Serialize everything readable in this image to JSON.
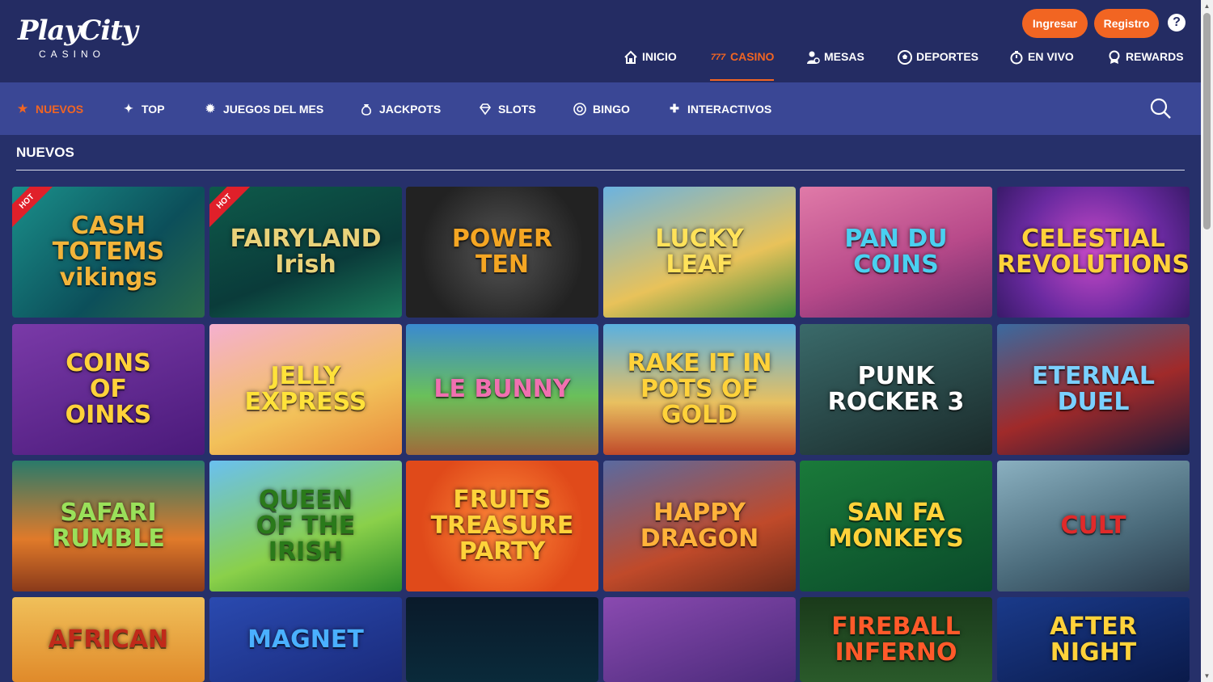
{
  "brand": {
    "logo_main": "PlayCity",
    "logo_sub": "CASINO"
  },
  "header": {
    "login_label": "Ingresar",
    "register_label": "Registro",
    "help_label": "?",
    "accent_color": "#f26522"
  },
  "mainnav": [
    {
      "label": "INICIO",
      "icon": "home-icon",
      "active": false
    },
    {
      "label": "CASINO",
      "icon": "777-icon",
      "active": true
    },
    {
      "label": "MESAS",
      "icon": "dealer-icon",
      "active": false
    },
    {
      "label": "DEPORTES",
      "icon": "soccer-ball-icon",
      "active": false
    },
    {
      "label": "EN VIVO",
      "icon": "stopwatch-icon",
      "active": false
    },
    {
      "label": "REWARDS",
      "icon": "award-icon",
      "active": false
    }
  ],
  "subnav": [
    {
      "label": "NUEVOS",
      "icon": "star-icon",
      "active": true
    },
    {
      "label": "TOP",
      "icon": "sparkles-icon",
      "active": false
    },
    {
      "label": "JUEGOS DEL MES",
      "icon": "badge-icon",
      "active": false
    },
    {
      "label": "JACKPOTS",
      "icon": "money-bag-icon",
      "active": false
    },
    {
      "label": "SLOTS",
      "icon": "diamond-icon",
      "active": false
    },
    {
      "label": "BINGO",
      "icon": "bingo-ball-icon",
      "active": false
    },
    {
      "label": "INTERACTIVOS",
      "icon": "puzzle-icon",
      "active": false
    }
  ],
  "section": {
    "title": "NUEVOS"
  },
  "games": [
    {
      "title": "CASH\nTOTEMS\nvikings",
      "hot": true,
      "bg": "linear-gradient(135deg,#1a8f8a,#0c4f5a 60%,#2a6a4a)",
      "color": "#f2b43a"
    },
    {
      "title": "FAIRYLAND\nIrish",
      "hot": true,
      "bg": "linear-gradient(160deg,#0e5a4a,#0a3b3a 60%,#1b7a5a)",
      "color": "#e9d27a"
    },
    {
      "title": "POWER\nTEN",
      "hot": false,
      "bg": "radial-gradient(circle,#555 0%,#222 70%)",
      "color": "#f5a623"
    },
    {
      "title": "LUCKY\nLEAF",
      "hot": false,
      "bg": "linear-gradient(160deg,#6bb3e0,#e8c25a 60%,#3a8a3a)",
      "color": "#ffe25a"
    },
    {
      "title": "PAN DU\nCOINS",
      "hot": false,
      "bg": "linear-gradient(160deg,#e07aa8,#b84a8a 55%,#6a2a6a)",
      "color": "#4ad0f0"
    },
    {
      "title": "CELESTIAL\nREVOLUTIONS",
      "hot": false,
      "bg": "radial-gradient(circle,#c84ac8 0%,#6a2aa0 60%,#3a1a6a)",
      "color": "#ffd23a"
    },
    {
      "title": "COINS\nOF\nOINKS",
      "hot": false,
      "bg": "linear-gradient(160deg,#7a3aa8,#4a1a7a)",
      "color": "#ffd23a"
    },
    {
      "title": "JELLY\nEXPRESS",
      "hot": false,
      "bg": "linear-gradient(160deg,#f5b0d0,#f2c15a 60%,#e88a3a)",
      "color": "#ffe23a"
    },
    {
      "title": "LE BUNNY",
      "hot": false,
      "bg": "linear-gradient(180deg,#3a8ad0,#6ac05a 55%,#a06a3a)",
      "color": "#f070b0"
    },
    {
      "title": "RAKE IT IN\nPOTS OF GOLD",
      "hot": false,
      "bg": "linear-gradient(180deg,#5ab0e0,#e8c060 60%,#c04a2a)",
      "color": "#ffd23a"
    },
    {
      "title": "PUNK\nROCKER 3",
      "hot": false,
      "bg": "linear-gradient(160deg,#3a6a6a,#1a2a2a)",
      "color": "#ffffff"
    },
    {
      "title": "ETERNAL\nDUEL",
      "hot": false,
      "bg": "linear-gradient(160deg,#3a6aa0,#a02a2a 55%,#1a1a3a)",
      "color": "#7ad0ff"
    },
    {
      "title": "SAFARI\nRUMBLE",
      "hot": false,
      "bg": "linear-gradient(180deg,#2a7a6a,#e07a2a 60%,#8a3a1a)",
      "color": "#9ae05a"
    },
    {
      "title": "QUEEN\nOF THE\nIRISH",
      "hot": false,
      "bg": "linear-gradient(160deg,#6ac0f0,#8ad04a 60%,#2a8a2a)",
      "color": "#2a7a1a"
    },
    {
      "title": "FRUITS\nTREASURE\nPARTY",
      "hot": false,
      "bg": "radial-gradient(circle,#ff8a3a 0%,#e04a1a 70%)",
      "color": "#ffd23a"
    },
    {
      "title": "HAPPY\nDRAGON",
      "hot": false,
      "bg": "linear-gradient(160deg,#5a6aa0,#c04a2a 60%,#6a2a1a)",
      "color": "#ffb23a"
    },
    {
      "title": "SAN FA\nMONKEYS",
      "hot": false,
      "bg": "linear-gradient(160deg,#1a7a3a,#0a4a2a)",
      "color": "#ffd23a"
    },
    {
      "title": "CULT",
      "hot": false,
      "bg": "linear-gradient(160deg,#8ab0c0,#4a6a7a 60%,#2a3a4a)",
      "color": "#e02a2a"
    },
    {
      "title": "AFRICAN",
      "hot": false,
      "bg": "linear-gradient(180deg,#f0c05a,#e08a2a)",
      "color": "#c02a1a"
    },
    {
      "title": "MAGNET",
      "hot": false,
      "bg": "linear-gradient(160deg,#2a4ab0,#1a2a7a)",
      "color": "#4ab0ff"
    },
    {
      "title": "",
      "hot": false,
      "bg": "linear-gradient(180deg,#0a1a2a,#0a2a3a)",
      "color": "#ffffff"
    },
    {
      "title": "",
      "hot": false,
      "bg": "linear-gradient(160deg,#8a4ab0,#4a2a7a)",
      "color": "#ffffff"
    },
    {
      "title": "FIREBALL\nINFERNO",
      "hot": false,
      "bg": "linear-gradient(180deg,#1a3a1a,#2a5a2a)",
      "color": "#ff5a2a"
    },
    {
      "title": "AFTER\nNIGHT",
      "hot": false,
      "bg": "linear-gradient(160deg,#1a3a8a,#0a1a4a)",
      "color": "#ffd23a"
    }
  ]
}
